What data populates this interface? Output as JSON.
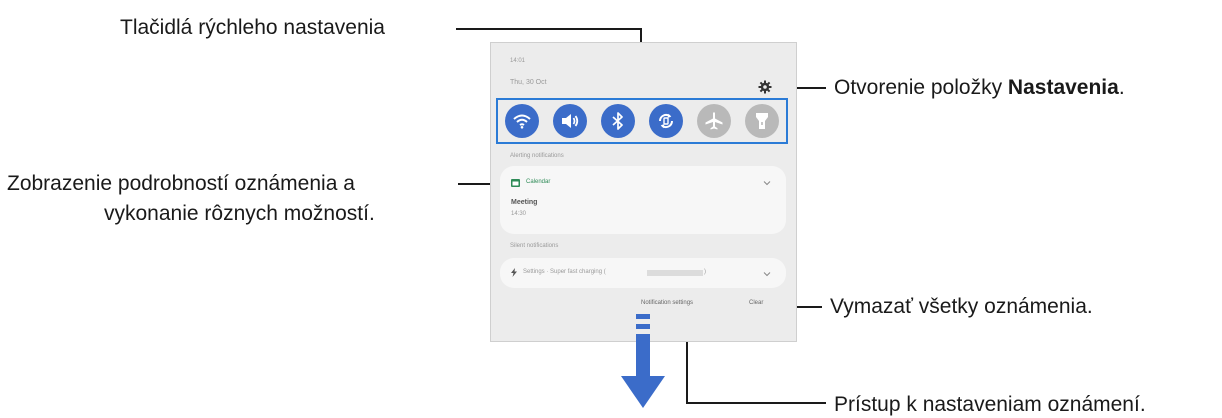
{
  "callouts": {
    "quick_buttons": "Tlačidlá rýchleho nastavenia",
    "settings_prefix": "Otvorenie položky ",
    "settings_bold": "Nastavenia",
    "settings_suffix": ".",
    "details_line1": "Zobrazenie podrobností oznámenia a",
    "details_line2": "vykonanie rôznych možností.",
    "clear_all": "Vymazať všetky oznámenia.",
    "notif_settings": "Prístup k nastaveniam oznámení."
  },
  "panel": {
    "time": "14:01",
    "date": "Thu, 30 Oct",
    "alerting_header": "Alerting notifications",
    "calendar_app": "Calendar",
    "event_title": "Meeting",
    "event_time": "14:30",
    "silent_header": "Silent notifications",
    "charging_text": "Settings · Super fast charging (",
    "notification_settings_button": "Notification settings",
    "clear_button": "Clear"
  },
  "quick_settings": [
    {
      "icon": "wifi-icon",
      "state": "on"
    },
    {
      "icon": "sound-icon",
      "state": "on"
    },
    {
      "icon": "bluetooth-icon",
      "state": "on"
    },
    {
      "icon": "auto-rotate-icon",
      "state": "on"
    },
    {
      "icon": "airplane-mode-icon",
      "state": "off"
    },
    {
      "icon": "flashlight-icon",
      "state": "off"
    }
  ],
  "colors": {
    "accent": "#3b6cc9",
    "highlight_border": "#2b7bd6",
    "calendar_green": "#2e8b57",
    "arrow": "#3b6cc9"
  }
}
